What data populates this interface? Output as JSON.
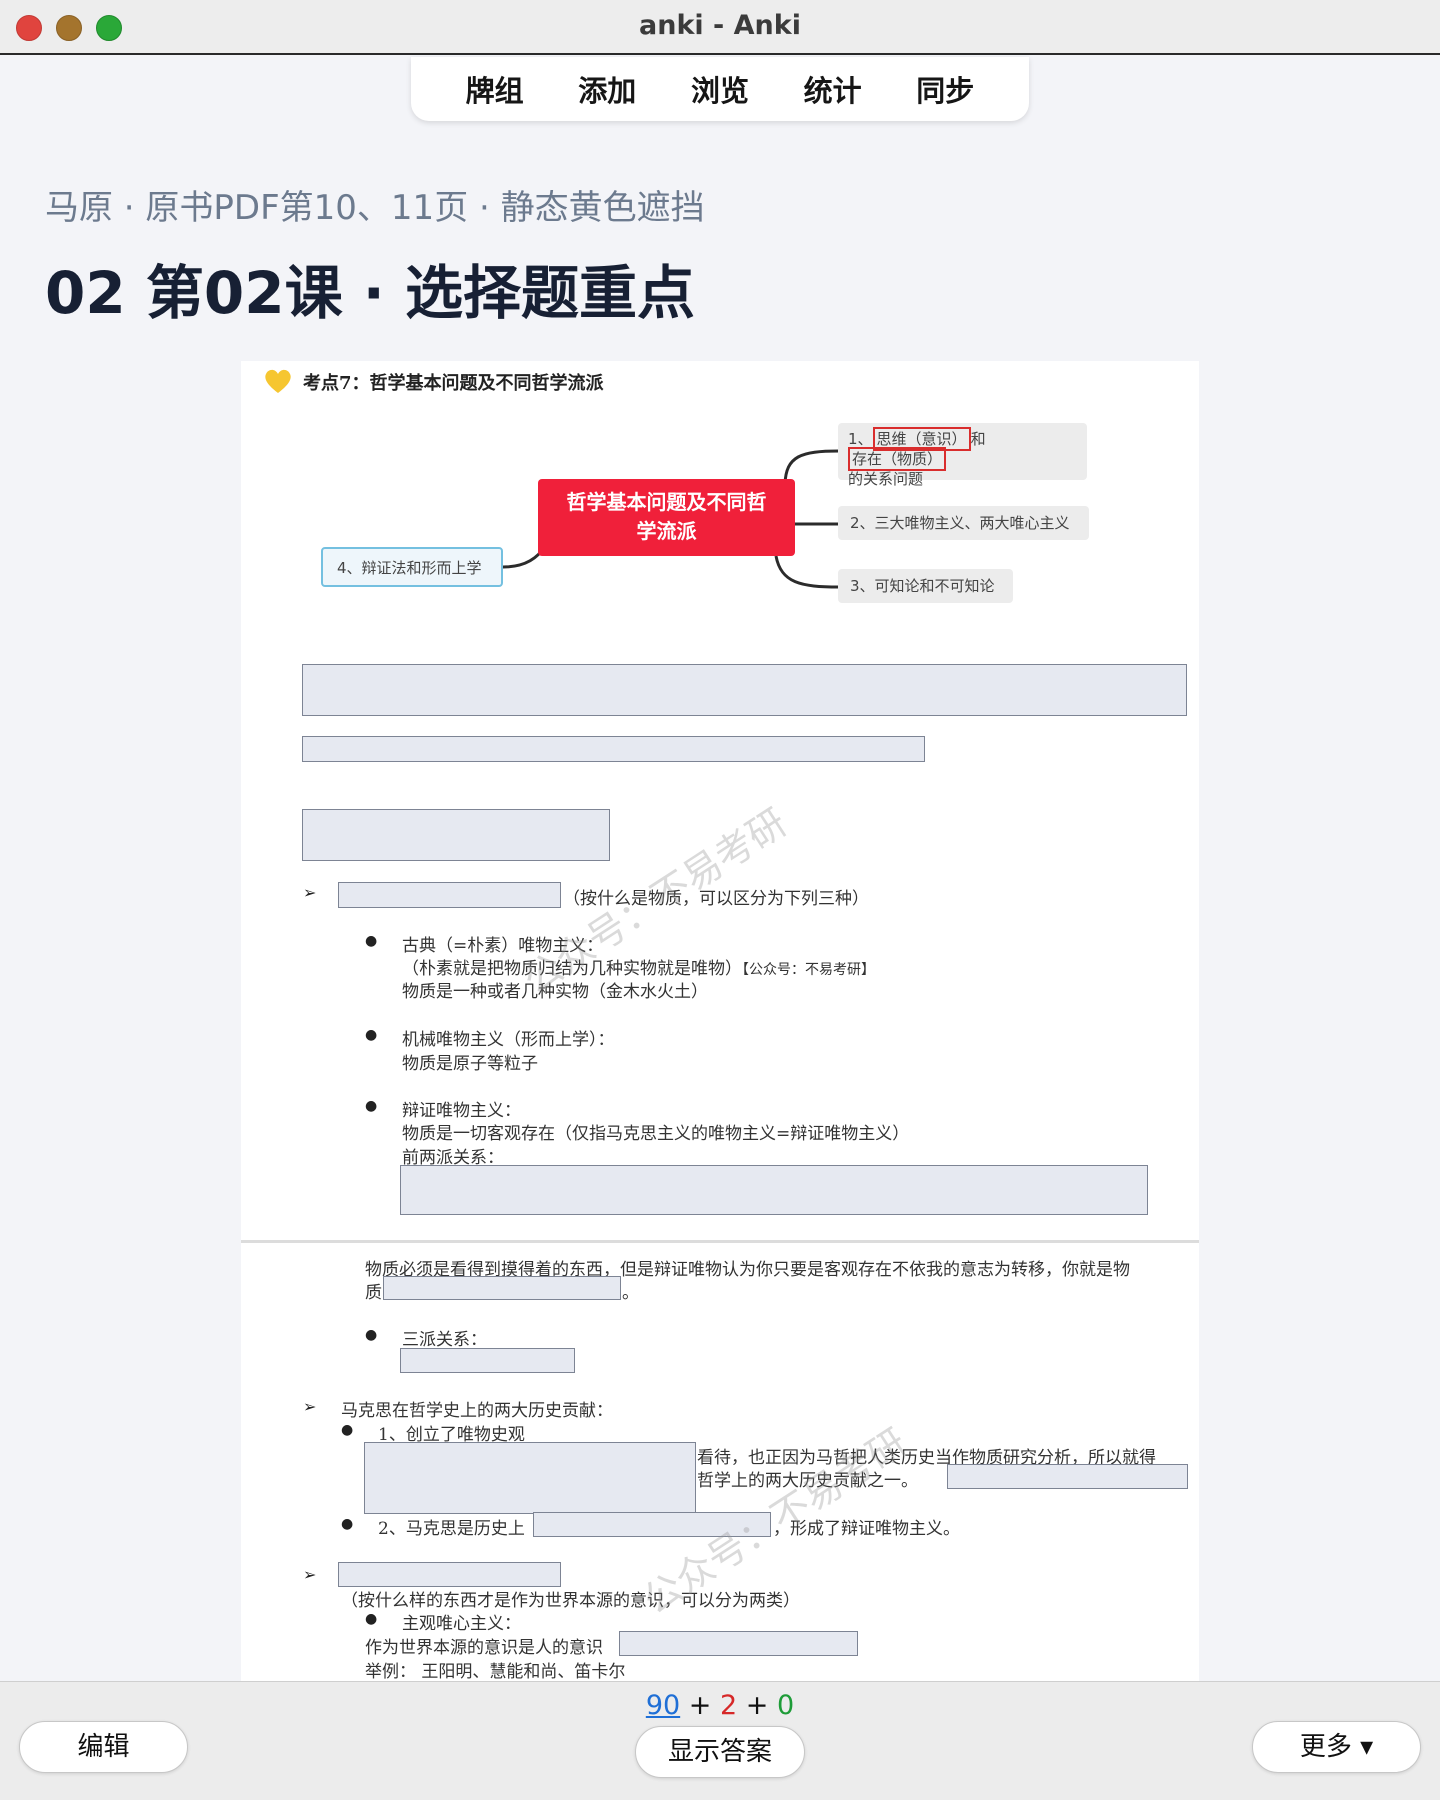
{
  "window": {
    "title": "anki - Anki"
  },
  "toolbar": {
    "tabs": [
      "牌组",
      "添加",
      "浏览",
      "统计",
      "同步"
    ]
  },
  "card": {
    "deck_path": "马原 · 原书PDF第10、11页 · 静态黄色遮挡",
    "title": "02 第02课 · 选择题重点"
  },
  "document": {
    "heart_icon_color": "#f6c630",
    "heading": "考点7：哲学基本问题及不同哲学流派",
    "mindmap": {
      "center": [
        "哲学基本问题及不同哲",
        "学流派"
      ],
      "node1_prefix": "1、",
      "node1_a": "思维（意识）",
      "node1_mid": "和",
      "node1_b": "存在（物质）",
      "node1_line2": "的关系问题",
      "node2": "2、三大唯物主义、两大唯心主义",
      "node3": "3、可知论和不可知论",
      "node4": "4、辩证法和形而上学"
    },
    "text": {
      "l1": "（按什么是物质，可以区分为下列三种）",
      "l2": "古典（=朴素）唯物主义：",
      "l3": "（朴素就是把物质归结为几种实物就是唯物）",
      "l3b": "【公众号：不易考研】",
      "l4": "物质是一种或者几种实物（金木水火土）",
      "l5": "机械唯物主义（形而上学）：",
      "l6": "物质是原子等粒子",
      "l7": "辩证唯物主义：",
      "l8": "物质是一切客观存在（仅指马克思主义的唯物主义=辩证唯物主义）",
      "l9": "前两派关系：",
      "l10": "物质必须是看得到摸得着的东西，但是辩证唯物认为你只要是客观存在不依我的意志为转移，你就是物",
      "l11": "质",
      "l11b": "。",
      "l12": "三派关系：",
      "l13": "马克思在哲学史上的两大历史贡献：",
      "l14": "1、创立了唯物史观",
      "l15": "看待，也正因为马哲把人类历史当作物质研究分析，所以就得",
      "l16": "哲学上的两大历史贡献之一。",
      "l17": "2、马克思是历史上",
      "l17b": "，形成了辩证唯物主义。",
      "l18": "（按什么样的东西才是作为世界本源的意识，可以分为两类）",
      "l19": "主观唯心主义：",
      "l20": "作为世界本源的意识是人的意识",
      "l21": "举例：  王阳明、慧能和尚、笛卡尔"
    },
    "watermarks": [
      "公众号：不易考研",
      "公众号：不易考研"
    ]
  },
  "bottom": {
    "edit_label": "编辑",
    "show_answer_label": "显示答案",
    "more_label": "更多 ▾",
    "count_new": "90",
    "count_learn": "2",
    "count_review": "0",
    "plus": "+",
    "count_colors": {
      "new": "#1f6fd6",
      "learn": "#d62828",
      "review": "#1e9c38"
    }
  }
}
